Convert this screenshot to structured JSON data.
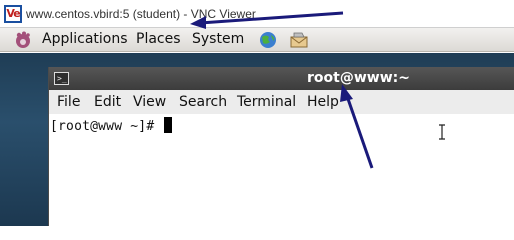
{
  "vnc_window": {
    "logo_text": "Ve",
    "title": "www.centos.vbird:5 (student) - VNC Viewer"
  },
  "panel": {
    "menus": [
      "Applications",
      "Places",
      "System"
    ],
    "launchers": [
      "web-browser-icon",
      "mail-client-icon"
    ]
  },
  "terminal": {
    "icon_text": ">_",
    "title": "root@www:~",
    "menu": [
      "File",
      "Edit",
      "View",
      "Search",
      "Terminal",
      "Help"
    ],
    "prompt": "[root@www ~]# "
  },
  "colors": {
    "annotation_arrow": "#1a1a7a",
    "desktop": "#2a4f6c",
    "terminal_titlebar": "#4a4a4a"
  }
}
